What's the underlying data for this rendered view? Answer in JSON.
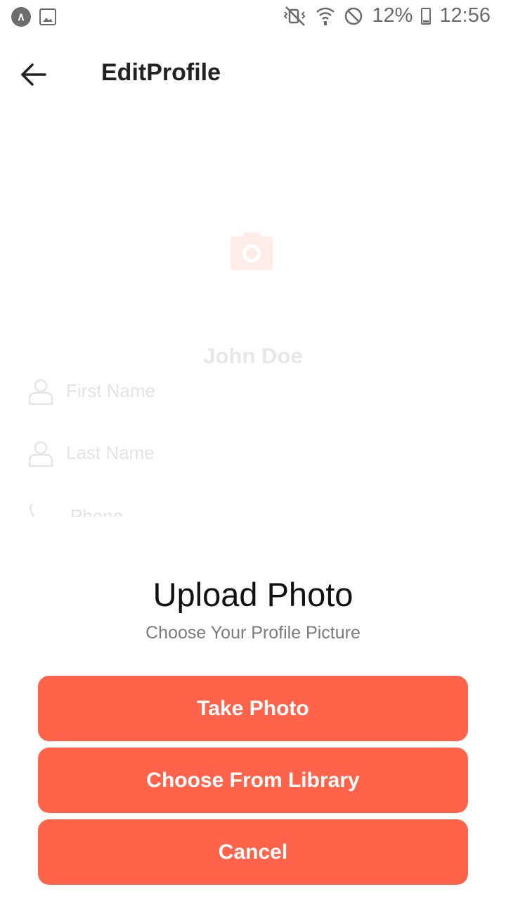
{
  "status_bar": {
    "app_icon": "expo-icon",
    "image_icon": "image-notification-icon",
    "icons": [
      "vibrate-off-icon",
      "wifi-icon",
      "do-not-disturb-icon",
      "battery-charging-icon"
    ],
    "battery": "12%",
    "time": "12:56"
  },
  "header": {
    "back_icon": "arrow-left-icon",
    "title": "EditProfile"
  },
  "profile": {
    "camera_icon": "camera-icon",
    "name": "John Doe",
    "fields": [
      {
        "icon": "user-icon",
        "placeholder": "First Name"
      },
      {
        "icon": "user-icon",
        "placeholder": "Last Name"
      },
      {
        "icon": "phone-icon",
        "placeholder": "Phone"
      }
    ]
  },
  "sheet": {
    "title": "Upload Photo",
    "subtitle": "Choose Your Profile Picture",
    "buttons": {
      "take_photo": "Take Photo",
      "choose_library": "Choose From Library",
      "cancel": "Cancel"
    }
  },
  "colors": {
    "accent": "#ff634a",
    "text_primary": "#111111",
    "text_secondary": "#7b7b7b"
  }
}
